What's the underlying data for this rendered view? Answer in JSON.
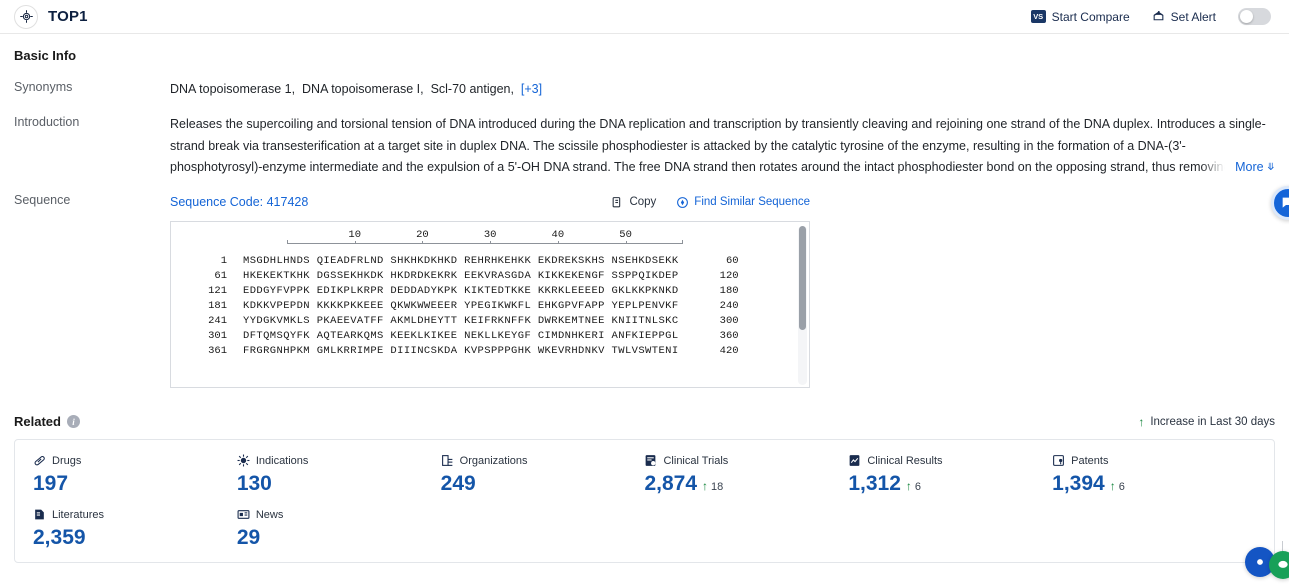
{
  "topbar": {
    "title": "TOP1",
    "logo_icon": "target-icon",
    "compare_label": "Start Compare",
    "compare_badge": "VS",
    "alert_label": "Set Alert",
    "alert_icon": "bell-upload-icon",
    "alert_toggle_state": "off"
  },
  "basic_info": {
    "heading": "Basic Info",
    "synonyms": {
      "label": "Synonyms",
      "items": [
        "DNA topoisomerase 1,",
        "DNA topoisomerase I,",
        "Scl-70 antigen,"
      ],
      "more_badge": "[+3]"
    },
    "introduction": {
      "label": "Introduction",
      "text": "Releases the supercoiling and torsional tension of DNA introduced during the DNA replication and transcription by transiently cleaving and rejoining one strand of the DNA duplex. Introduces a single-strand break via transesterification at a target site in duplex DNA. The scissile phosphodiester is attacked by the catalytic tyrosine of the enzyme, resulting in the formation of a DNA-(3'-phosphotyrosyl)-enzyme intermediate and the expulsion of a 5'-OH DNA strand. The free DNA strand then rotates around the intact phosphodiester bond on the opposing strand, thus removing DNA supercoils. Finally, in the religation step, the DNA 5'-OH attacks the covalent intermediate.",
      "more_label": "More"
    },
    "sequence": {
      "label": "Sequence",
      "code_label": "Sequence Code: 417428",
      "copy_label": "Copy",
      "copy_icon": "copy-icon",
      "find_similar_label": "Find Similar Sequence",
      "find_similar_icon": "similar-search-icon",
      "ruler_ticks": [
        "10",
        "20",
        "30",
        "40",
        "50"
      ],
      "rows": [
        {
          "start": "1",
          "blocks": "MSGDHLHNDS QIEADFRLND SHKHKDKHKD REHRHKEHKK EKDREKSKHS NSEHKDSEKK",
          "end": "60"
        },
        {
          "start": "61",
          "blocks": "HKEKEKTKHK DGSSEKHKDK HKDRDKEKRK EEKVRASGDA KIKKEKENGF SSPPQIKDEP",
          "end": "120"
        },
        {
          "start": "121",
          "blocks": "EDDGYFVPPK EDIKPLKRPR DEDDADYKPK KIKTEDTKKE KKRKLEEEED GKLKKPKNKD",
          "end": "180"
        },
        {
          "start": "181",
          "blocks": "KDKKVPEPDN KKKKPKKEEE QKWKWWEEER YPEGIKWKFL EHKGPVFAPP YEPLPENVKF",
          "end": "240"
        },
        {
          "start": "241",
          "blocks": "YYDGKVMKLS PKAEEVATFF AKMLDHEYTT KEIFRKNFFK DWRKEMTNEE KNIITNLSKC",
          "end": "300"
        },
        {
          "start": "301",
          "blocks": "DFTQMSQYFK AQTEARKQMS KEEKLKIKEE NEKLLKEYGF CIMDNHKERI ANFKIEPPGL",
          "end": "360"
        },
        {
          "start": "361",
          "blocks": "FRGRGNHPKM GMLKRRIMPE DIIINCSKDA KVPSPPPGHK WKEVRHDNKV TWLVSWTENI",
          "end": "420"
        }
      ]
    }
  },
  "related": {
    "heading": "Related",
    "info_icon": "info-icon",
    "legend": {
      "arrow_icon": "arrow-up-icon",
      "label": "Increase in Last 30 days"
    },
    "stats": [
      {
        "icon": "capsule-icon",
        "label": "Drugs",
        "value": "197",
        "delta": ""
      },
      {
        "icon": "virus-icon",
        "label": "Indications",
        "value": "130",
        "delta": ""
      },
      {
        "icon": "building-icon",
        "label": "Organizations",
        "value": "249",
        "delta": ""
      },
      {
        "icon": "clipboard-trial-icon",
        "label": "Clinical Trials",
        "value": "2,874",
        "delta": "18"
      },
      {
        "icon": "results-chart-icon",
        "label": "Clinical Results",
        "value": "1,312",
        "delta": "6"
      },
      {
        "icon": "patent-icon",
        "label": "Patents",
        "value": "1,394",
        "delta": "6"
      },
      {
        "icon": "book-icon",
        "label": "Literatures",
        "value": "2,359",
        "delta": ""
      },
      {
        "icon": "news-icon",
        "label": "News",
        "value": "29",
        "delta": ""
      }
    ]
  },
  "floating": {
    "right_button_icon": "chat-bubble-icon",
    "bottom_button_a_icon": "support-icon",
    "bottom_button_b_icon": "wechat-icon"
  },
  "colors": {
    "link": "#1464d6",
    "stat_value": "#1455a8",
    "increase": "#14853d",
    "brand_dark": "#0d2040"
  }
}
